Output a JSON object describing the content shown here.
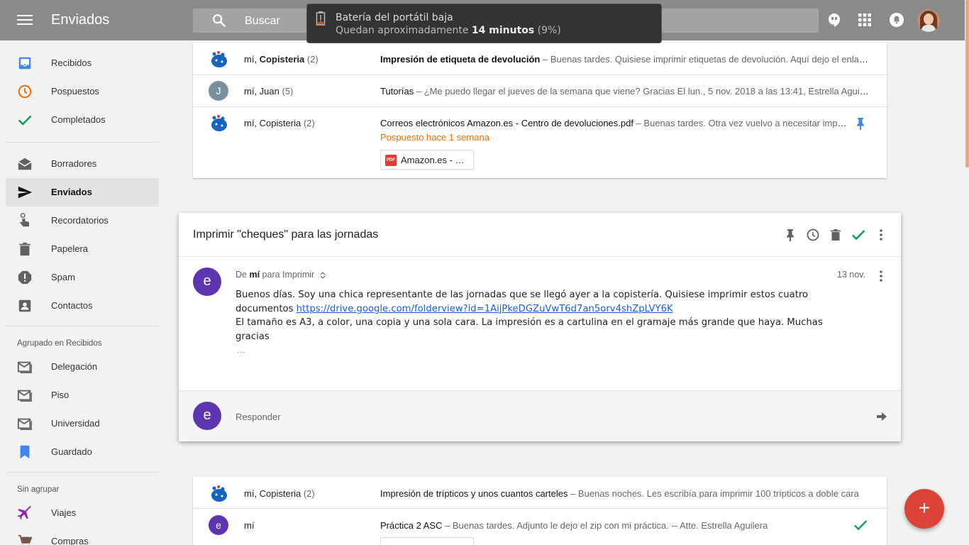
{
  "header": {
    "title": "Enviados",
    "search_placeholder": "Buscar"
  },
  "battery": {
    "title": "Batería del portátil baja",
    "sub_prefix": "Quedan aproximadamente",
    "minutes": "14 minutos",
    "percent": "(9%)"
  },
  "sidebar": {
    "items": [
      {
        "label": "Recibidos",
        "icon": "inbox-icon",
        "color": "#4285f4"
      },
      {
        "label": "Pospuestos",
        "icon": "clock-icon",
        "color": "#ef6c00"
      },
      {
        "label": "Completados",
        "icon": "check-icon",
        "color": "#0f9d58"
      },
      {
        "label": "Borradores",
        "icon": "drafts-icon",
        "color": "#616161"
      },
      {
        "label": "Enviados",
        "icon": "send-icon",
        "color": "#212121"
      },
      {
        "label": "Recordatorios",
        "icon": "reminder-icon",
        "color": "#616161"
      },
      {
        "label": "Papelera",
        "icon": "trash-icon",
        "color": "#616161"
      },
      {
        "label": "Spam",
        "icon": "spam-icon",
        "color": "#616161"
      },
      {
        "label": "Contactos",
        "icon": "contacts-icon",
        "color": "#616161"
      }
    ],
    "bundled_header": "Agrupado en Recibidos",
    "bundled": [
      {
        "label": "Delegación",
        "icon": "mail-icon"
      },
      {
        "label": "Piso",
        "icon": "mail-icon"
      },
      {
        "label": "Universidad",
        "icon": "mail-icon"
      },
      {
        "label": "Guardado",
        "icon": "bookmark-icon",
        "color": "#4285f4"
      }
    ],
    "unbundled_header": "Sin agrupar",
    "unbundled": [
      {
        "label": "Viajes",
        "icon": "plane-icon",
        "color": "#8e24aa"
      },
      {
        "label": "Compras",
        "icon": "cart-icon",
        "color": "#795548"
      }
    ]
  },
  "top_list": [
    {
      "sender_prefix": "mí, ",
      "sender_name": "Copisteria",
      "count": "(2)",
      "subject": "Impresión de etiqueta de devolución",
      "snippet": " – Buenas tardes. Quisiese imprimir etiquetas de devolución. Aquí dejo el enlace a las etiquetas"
    },
    {
      "sender_prefix": "mí, ",
      "sender_name": "Juan",
      "count": "(5)",
      "avatar_letter": "J",
      "subject": "Tutorías",
      "snippet": " – ¿Me puedo llegar el jueves de la semana que viene? Gracias El lun., 5 nov. 2018 a las 13:41, Estrella Aguilera"
    },
    {
      "sender_prefix": "mí, ",
      "sender_name": "Copisteria",
      "count": "(2)",
      "subject": "Correos electrónicos Amazon.es - Centro de devoluciones.pdf",
      "snippet": " – Buenas tardes. Otra vez vuelvo a necesitar imprimir",
      "snoozed": "Pospuesto hace 1 semana",
      "attachment": "Amazon.es - …"
    }
  ],
  "thread": {
    "title": "Imprimir \"cheques\" para las jornadas",
    "from_prefix": "De",
    "from_name": "mí",
    "to": "para Imprimir",
    "date": "13 nov.",
    "avatar_letter": "e",
    "body_line1": "Buenos días. Soy una chica representante de las jornadas que se llegó ayer a la copistería. Quisiese imprimir estos cuatro",
    "body_line2_prefix": "documentos ",
    "link": "https://drive.google.com/folderview?id=1AijPkeDGZuVwT6d7an5orv4shZpLVY6K",
    "body_line3": "El tamaño es A3, a color, una copia y una sola cara. La impresión es a cartulina en el gramaje más grande que haya. Muchas gracias",
    "ellipsis": "…",
    "reply_label": "Responder"
  },
  "bottom_list": [
    {
      "sender_prefix": "mí, ",
      "sender_name": "Copisteria",
      "count": "(2)",
      "subject": "Impresión de trípticos y unos cuantos carteles",
      "snippet": " – Buenas noches. Les escribía para imprimir 100 trípticos a doble cara"
    },
    {
      "sender_name": "mí",
      "avatar_letter": "e",
      "subject": "Práctica 2 ASC",
      "snippet": " – Buenas tardes. Adjunto le dejo el zip con mi práctica. -- Atte. Estrella Aguilera"
    }
  ],
  "fab": {
    "label": "+",
    "color": "#db4437"
  },
  "colors": {
    "header": "#8a8a8a",
    "accent_blue": "#4285f4",
    "snooze_orange": "#ef6c00",
    "done_green": "#0f9d58",
    "avatar_purple": "#5e35b1"
  }
}
